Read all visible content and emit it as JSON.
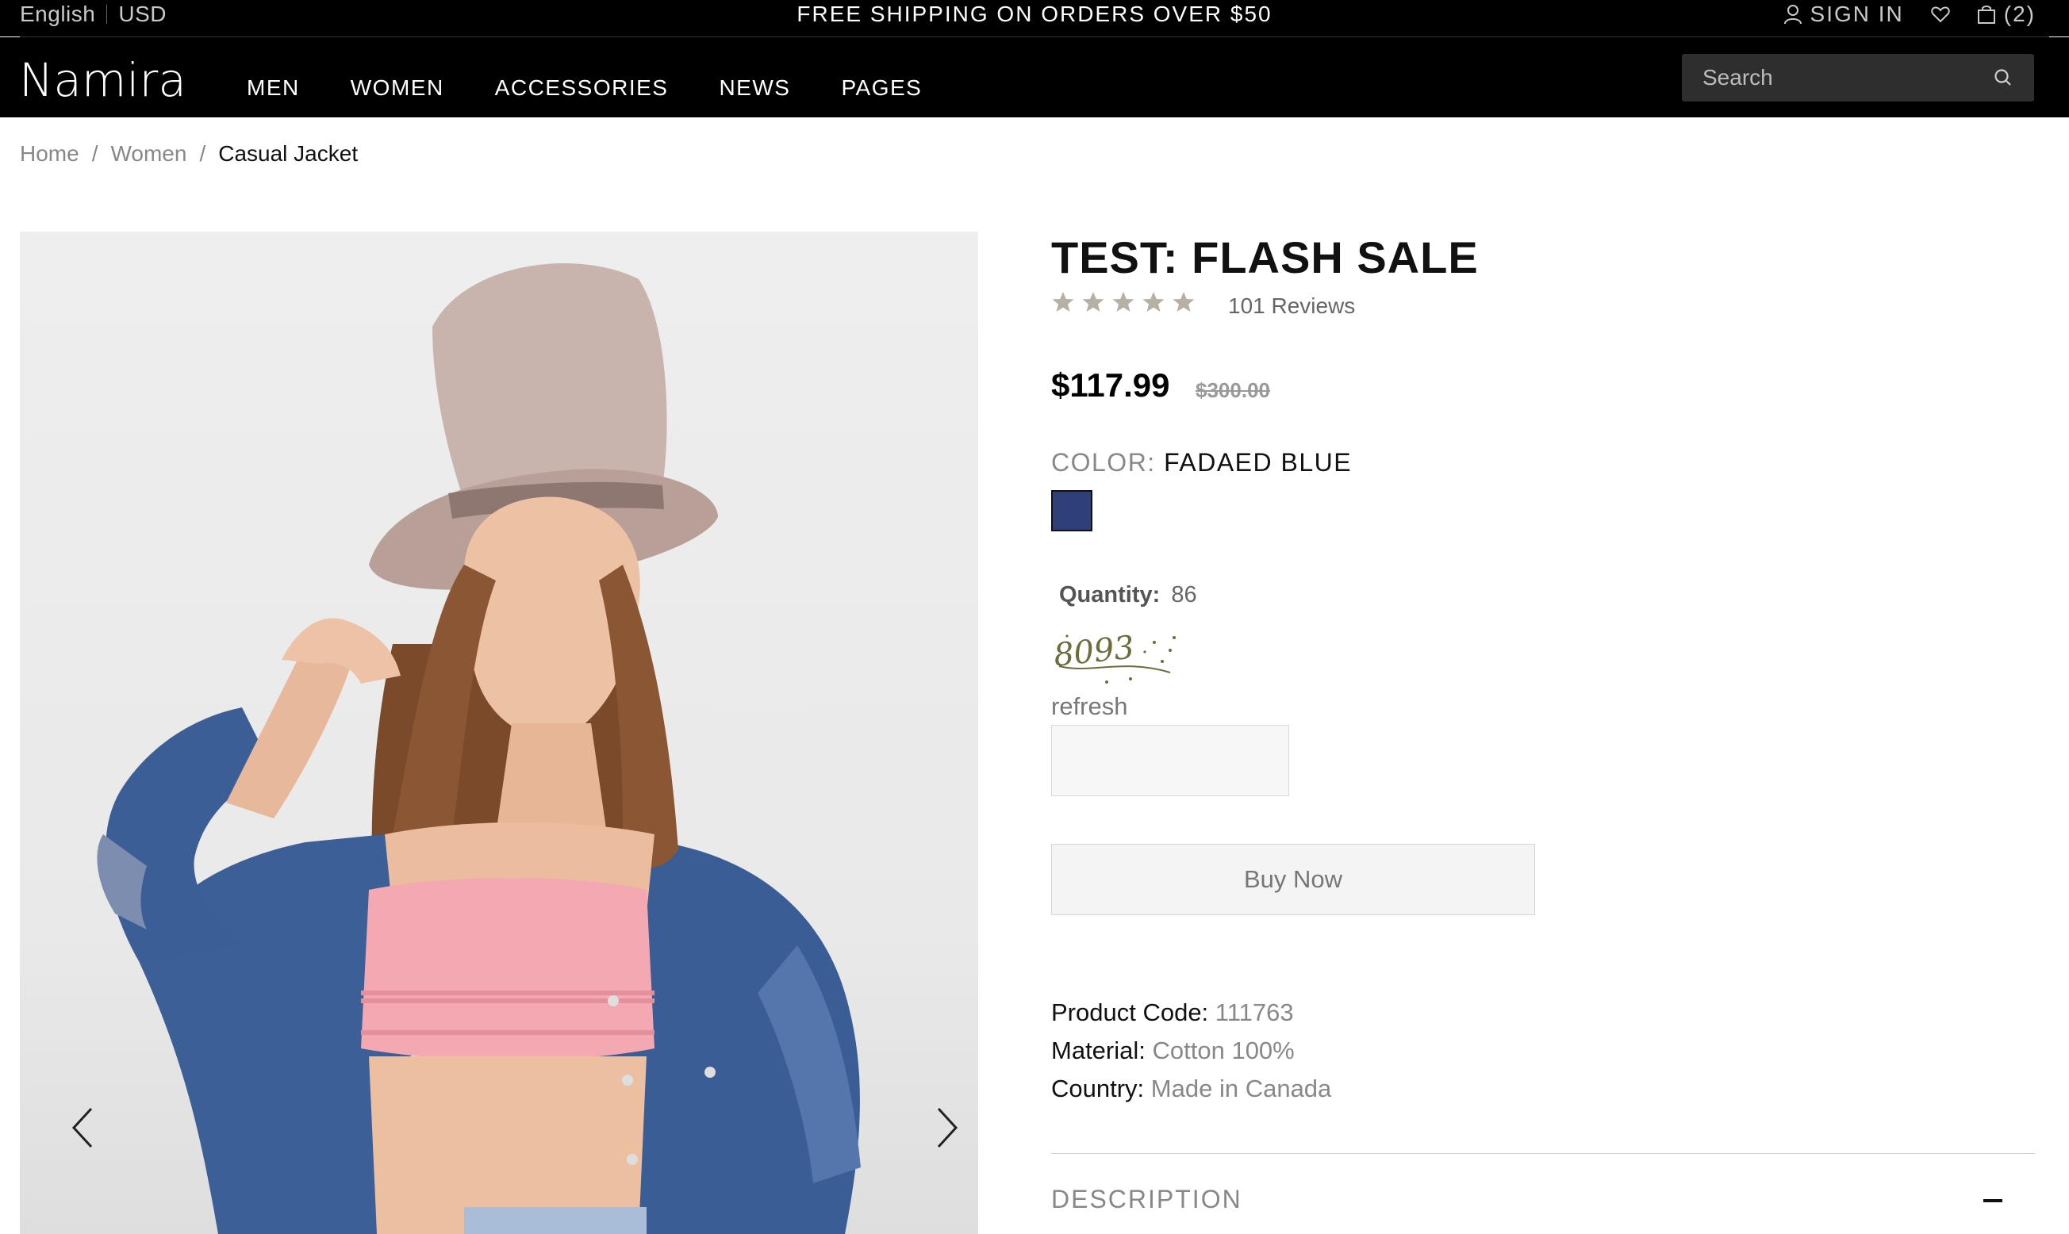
{
  "topbar": {
    "language": "English",
    "currency": "USD",
    "promo": "FREE SHIPPING ON ORDERS OVER $50",
    "sign_in": "SIGN IN",
    "cart_count": "(2)"
  },
  "header": {
    "logo": "Namira",
    "nav": [
      "MEN",
      "WOMEN",
      "ACCESSORIES",
      "NEWS",
      "PAGES"
    ],
    "search_placeholder": "Search"
  },
  "breadcrumb": {
    "home": "Home",
    "category": "Women",
    "current": "Casual Jacket"
  },
  "product": {
    "title": "TEST: FLASH SALE",
    "rating": 5,
    "reviews": "101 Reviews",
    "price": "$117.99",
    "old_price": "$300.00",
    "color_label": "COLOR:",
    "color_value": "FADAED BLUE",
    "swatch_color": "#2f3f7a",
    "quantity_label": "Quantity:",
    "quantity_value": "86",
    "captcha_text": "8093",
    "refresh_label": "refresh",
    "buy_label": "Buy Now",
    "specs": [
      {
        "label": "Product Code:",
        "value": "111763"
      },
      {
        "label": "Material:",
        "value": "Cotton 100%"
      },
      {
        "label": "Country:",
        "value": "Made in Canada"
      }
    ],
    "description_label": "DESCRIPTION"
  }
}
